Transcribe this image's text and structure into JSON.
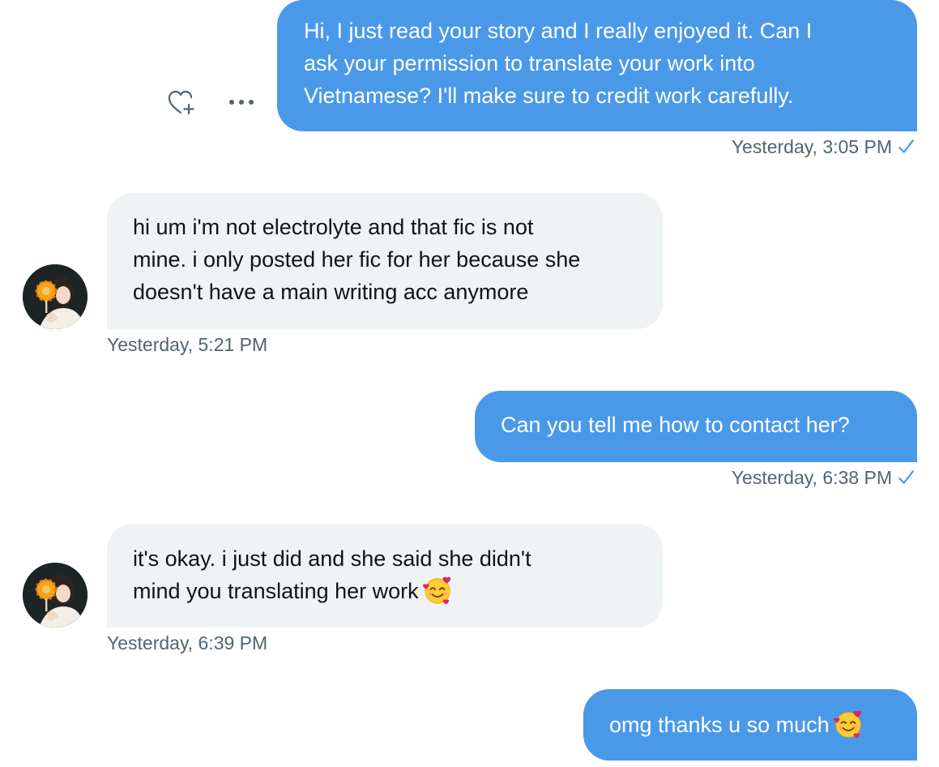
{
  "colors": {
    "outgoing_bubble": "#4a99e9",
    "incoming_bubble": "#eff3f4",
    "timestamp_text": "#536471",
    "read_check": "#4a99e9"
  },
  "messages": [
    {
      "direction": "outgoing",
      "lines": [
        "Hi, I just read your story and I really enjoyed it. Can I",
        "ask your permission to translate your work into",
        "Vietnamese? I'll make sure to credit work carefully."
      ],
      "timestamp": "Yesterday, 3:05 PM",
      "read": true,
      "actions": [
        "heart-plus-icon",
        "more-icon"
      ]
    },
    {
      "direction": "incoming",
      "lines": [
        "hi um i'm not electrolyte and that fic is not",
        "mine. i only posted her fic for her because she",
        "doesn't have a main writing acc anymore"
      ],
      "timestamp": "Yesterday, 5:21 PM"
    },
    {
      "direction": "outgoing",
      "lines": [
        "Can you tell me how to contact her?"
      ],
      "timestamp": "Yesterday, 6:38 PM",
      "read": true
    },
    {
      "direction": "incoming",
      "lines": [
        "it's okay. i just did and she said she didn't",
        "mind you translating her work"
      ],
      "emoji": "smiling-face-with-hearts",
      "timestamp": "Yesterday, 6:39 PM"
    },
    {
      "direction": "outgoing",
      "lines": [
        "omg thanks u so much"
      ],
      "emoji": "smiling-face-with-hearts"
    }
  ]
}
